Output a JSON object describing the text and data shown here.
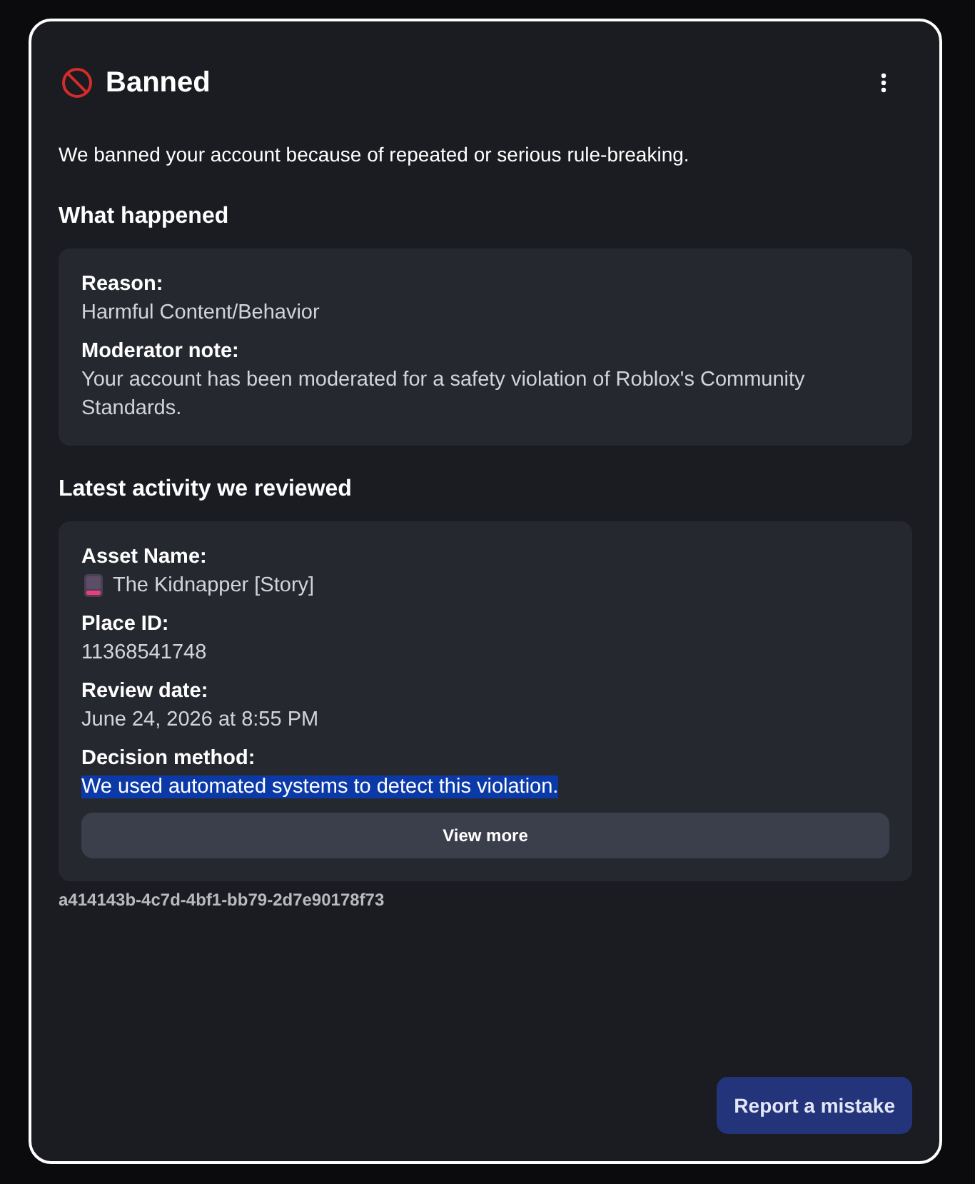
{
  "header": {
    "title": "Banned"
  },
  "description": "We banned your account because of repeated or serious rule-breaking.",
  "sections": [
    {
      "heading": "What happened",
      "fields": [
        {
          "kind": "text",
          "label": "Reason:",
          "value": "Harmful Content/Behavior",
          "highlighted": false
        },
        {
          "kind": "text",
          "label": "Moderator note:",
          "value": "Your account has been moderated for a safety violation of Roblox's Community Standards.",
          "highlighted": false
        }
      ]
    },
    {
      "heading": "Latest activity we reviewed",
      "fields": [
        {
          "kind": "asset",
          "label": "Asset Name:",
          "value": "The Kidnapper [Story]",
          "highlighted": false
        },
        {
          "kind": "text",
          "label": "Place ID:",
          "value": "11368541748",
          "highlighted": false
        },
        {
          "kind": "text",
          "label": "Review date:",
          "value": "June 24, 2026 at 8:55 PM",
          "highlighted": false
        },
        {
          "kind": "text",
          "label": "Decision method:",
          "value": "We used automated systems to detect this violation.",
          "highlighted": true
        }
      ],
      "button": "View more"
    }
  ],
  "reference_id": "a414143b-4c7d-4bf1-bb79-2d7e90178f73",
  "report_button": "Report a mistake"
}
